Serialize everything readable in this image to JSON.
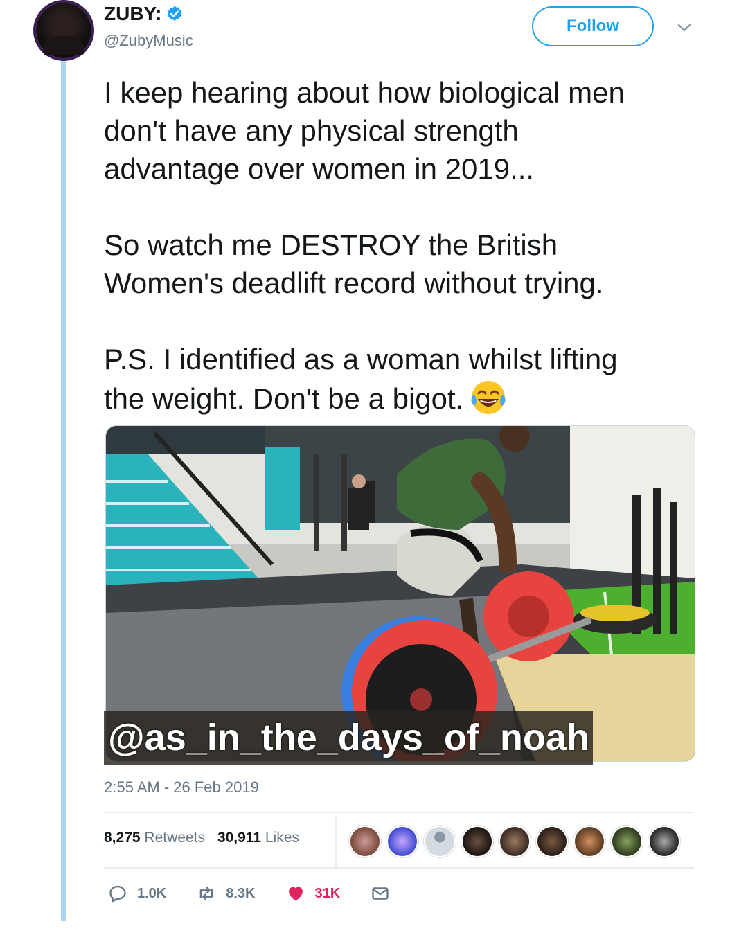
{
  "user": {
    "name": "ZUBY:",
    "handle": "@ZubyMusic",
    "verified": true
  },
  "follow_label": "Follow",
  "tweet": {
    "text": "I keep hearing about how biological men\ndon't have any physical strength\nadvantage over women in 2019...\n\nSo watch me DESTROY the British\nWomen's deadlift record without trying.\n\nP.S. I identified as a woman whilst lifting\nthe weight. Don't be a bigot.",
    "emoji": "face-with-tears-of-joy"
  },
  "watermark": "@as_in_the_days_of_noah",
  "timestamp": "2:55 AM - 26 Feb 2019",
  "stats": {
    "retweets_count": "8,275",
    "retweets_label": "Retweets",
    "likes_count": "30,911",
    "likes_label": "Likes"
  },
  "actions": {
    "reply": "1.0K",
    "retweet": "8.3K",
    "like": "31K"
  },
  "colors": {
    "accent": "#1da1f2",
    "like": "#e0245e",
    "thread_line": "#a9d5f3"
  }
}
